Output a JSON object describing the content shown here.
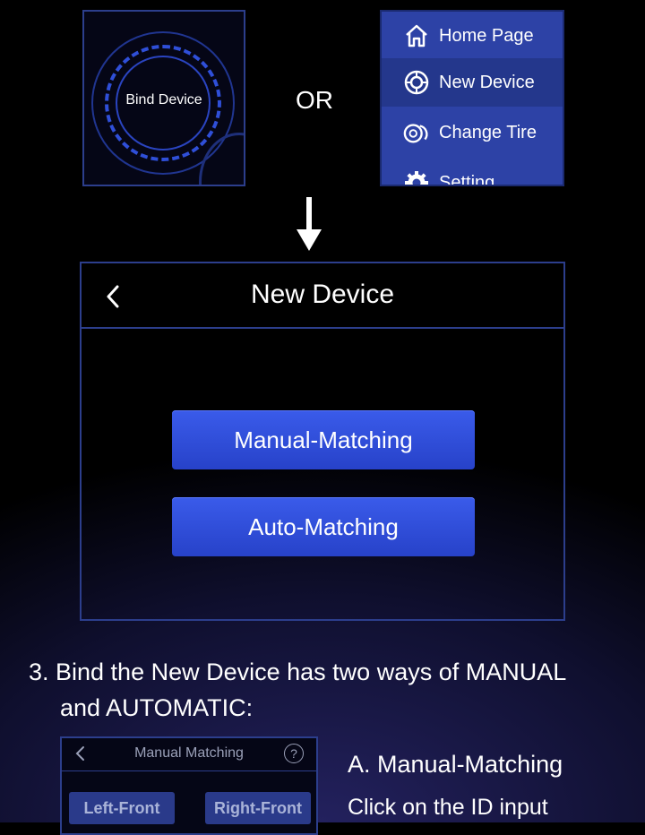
{
  "bind_panel": {
    "label": "Bind Device"
  },
  "or_label": "OR",
  "menu": {
    "items": [
      {
        "label": "Home Page",
        "icon": "home-icon"
      },
      {
        "label": "New Device",
        "icon": "tire-icon",
        "active": true
      },
      {
        "label": "Change Tire",
        "icon": "tires-swap-icon"
      },
      {
        "label": "Setting",
        "icon": "gear-icon"
      }
    ]
  },
  "app": {
    "title": "New Device",
    "manual_button": "Manual-Matching",
    "auto_button": "Auto-Matching"
  },
  "instructions": {
    "line1": "3. Bind the New Device has two ways of MANUAL",
    "line2": "and AUTOMATIC:"
  },
  "mini": {
    "title": "Manual Matching",
    "help": "?",
    "left_front": "Left-Front",
    "right_front": "Right-Front"
  },
  "side": {
    "heading": "A. Manual-Matching",
    "text": "Click on the ID input"
  },
  "colors": {
    "accent": "#2f4fd8",
    "menu_bg": "#2d42a6",
    "button": "#3151e0",
    "border": "#2c3e8c"
  }
}
